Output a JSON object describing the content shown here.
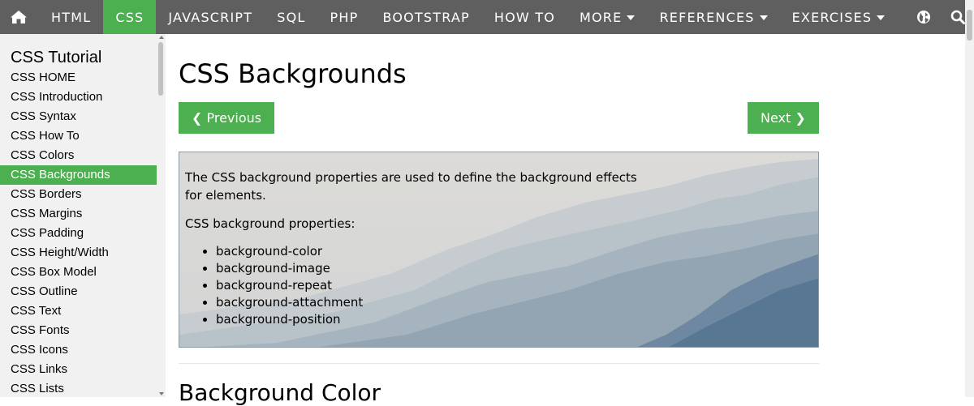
{
  "topnav": {
    "items": [
      {
        "label": "HTML"
      },
      {
        "label": "CSS"
      },
      {
        "label": "JAVASCRIPT"
      },
      {
        "label": "SQL"
      },
      {
        "label": "PHP"
      },
      {
        "label": "BOOTSTRAP"
      },
      {
        "label": "HOW TO"
      },
      {
        "label": "MORE"
      },
      {
        "label": "REFERENCES"
      },
      {
        "label": "EXERCISES"
      }
    ],
    "home_icon": "home-icon",
    "globe_icon": "globe-icon",
    "search_icon": "search-icon"
  },
  "sidebar": {
    "title": "CSS Tutorial",
    "items": [
      {
        "label": "CSS HOME"
      },
      {
        "label": "CSS Introduction"
      },
      {
        "label": "CSS Syntax"
      },
      {
        "label": "CSS How To"
      },
      {
        "label": "CSS Colors"
      },
      {
        "label": "CSS Backgrounds"
      },
      {
        "label": "CSS Borders"
      },
      {
        "label": "CSS Margins"
      },
      {
        "label": "CSS Padding"
      },
      {
        "label": "CSS Height/Width"
      },
      {
        "label": "CSS Box Model"
      },
      {
        "label": "CSS Outline"
      },
      {
        "label": "CSS Text"
      },
      {
        "label": "CSS Fonts"
      },
      {
        "label": "CSS Icons"
      },
      {
        "label": "CSS Links"
      },
      {
        "label": "CSS Lists"
      }
    ]
  },
  "main": {
    "title": "CSS Backgrounds",
    "prev_label": "❮ Previous",
    "next_label": "Next ❯",
    "intro_text": "The CSS background properties are used to define the background effects for elements.",
    "properties_heading": "CSS background properties:",
    "properties": [
      "background-color",
      "background-image",
      "background-repeat",
      "background-attachment",
      "background-position"
    ],
    "section_title": "Background Color"
  },
  "colors": {
    "nav_bg": "#5f5f5f",
    "accent": "#4caf50",
    "sidebar_bg": "#f1f1f1"
  }
}
